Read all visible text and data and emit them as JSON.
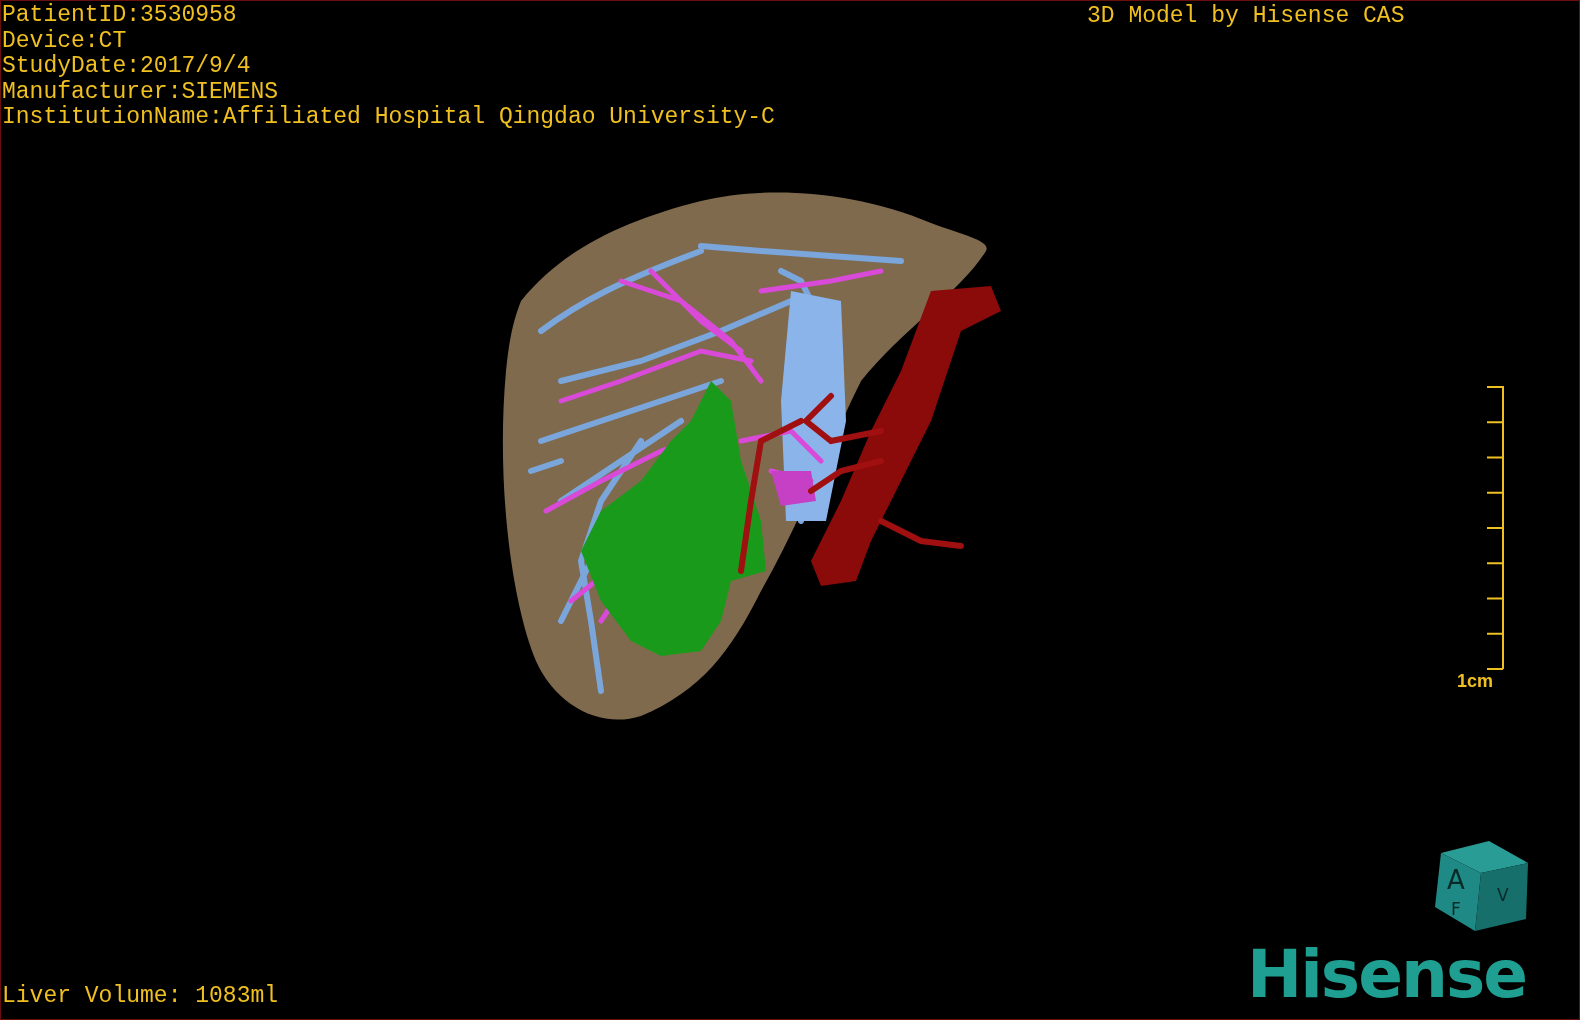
{
  "patient_info": [
    "PatientID:3530958",
    "Device:CT",
    "StudyDate:2017/9/4",
    "Manufacturer:SIEMENS",
    "InstitutionName:Affiliated Hospital Qingdao University-C"
  ],
  "header_right": "3D Model by Hisense CAS",
  "scale_bar": {
    "label": "1cm"
  },
  "orientation_cube": {
    "labels": [
      "A",
      "F",
      "V"
    ]
  },
  "logo": "Hisense",
  "liver_volume": "Liver Volume: 1083ml"
}
